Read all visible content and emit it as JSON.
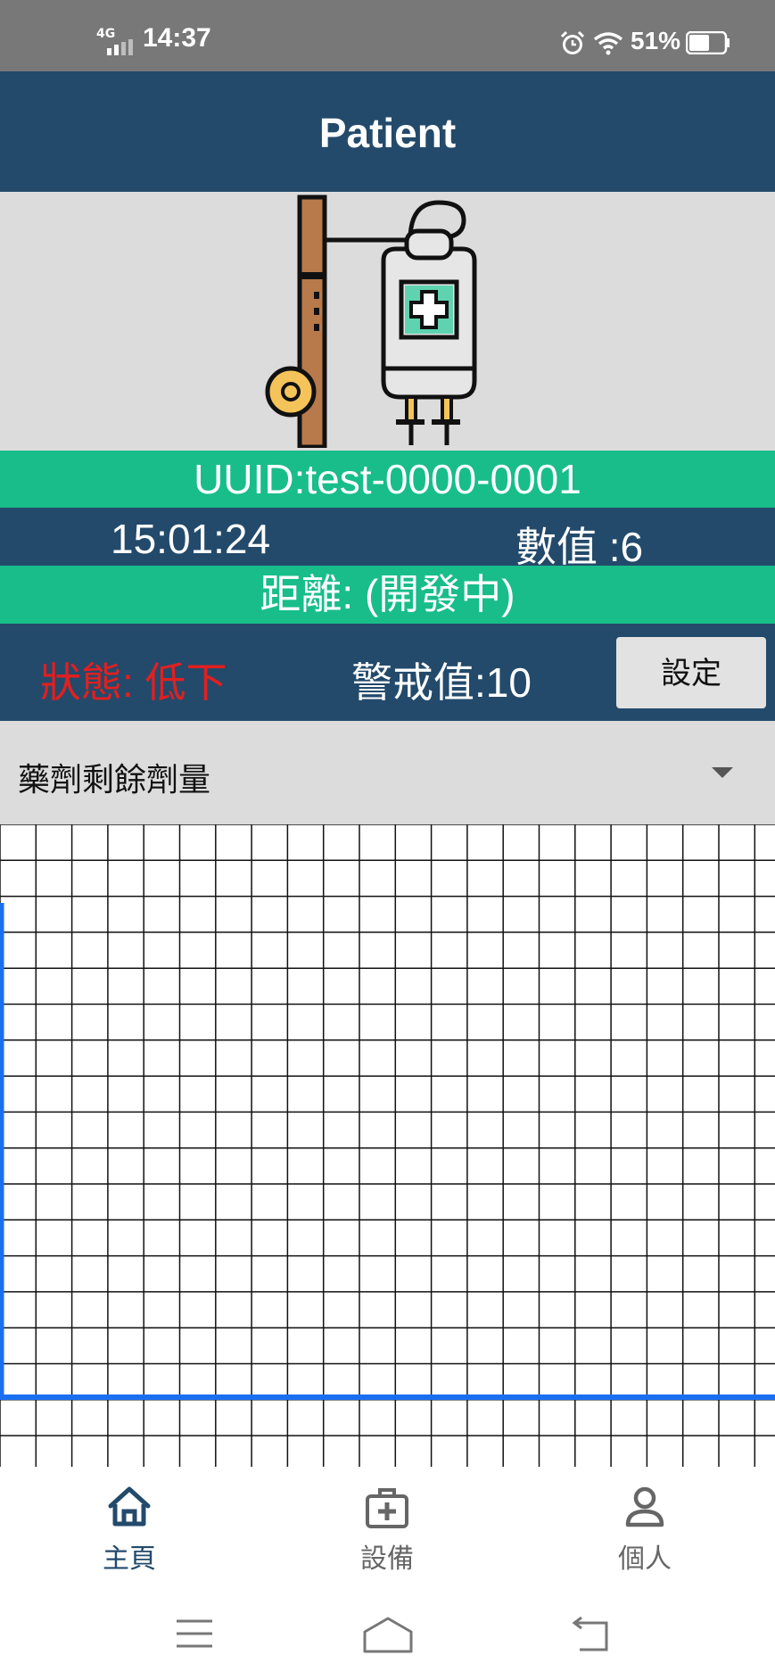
{
  "status_bar": {
    "network": "4G",
    "time": "14:37",
    "battery_percent": "51%",
    "battery_level": 0.51,
    "icons": [
      "signal-icon",
      "alarm-icon",
      "wifi-icon",
      "battery-icon"
    ]
  },
  "header": {
    "title": "Patient"
  },
  "device": {
    "uuid": "UUID:test-0000-0001",
    "timestamp": "15:01:24",
    "value": "數值 :6",
    "distance": "距離: (開發中)",
    "state": "狀態: 低下",
    "threshold": "警戒值:10",
    "set_button": "設定"
  },
  "dropdown": {
    "selected": "藥劑剩餘劑量",
    "icon": "chevron-down-icon"
  },
  "nav": {
    "items": [
      {
        "label": "主頁",
        "icon": "home-icon"
      },
      {
        "label": "設備",
        "icon": "medical-kit-icon"
      },
      {
        "label": "個人",
        "icon": "person-icon"
      }
    ],
    "active_index": 0
  },
  "system_nav": {
    "icons": [
      "menu-icon",
      "home-outline-icon",
      "back-icon"
    ]
  },
  "colors": {
    "primary": "#234a6b",
    "accent": "#18bd8a",
    "alert": "#e02020",
    "chart_line": "#1a6ff0"
  }
}
